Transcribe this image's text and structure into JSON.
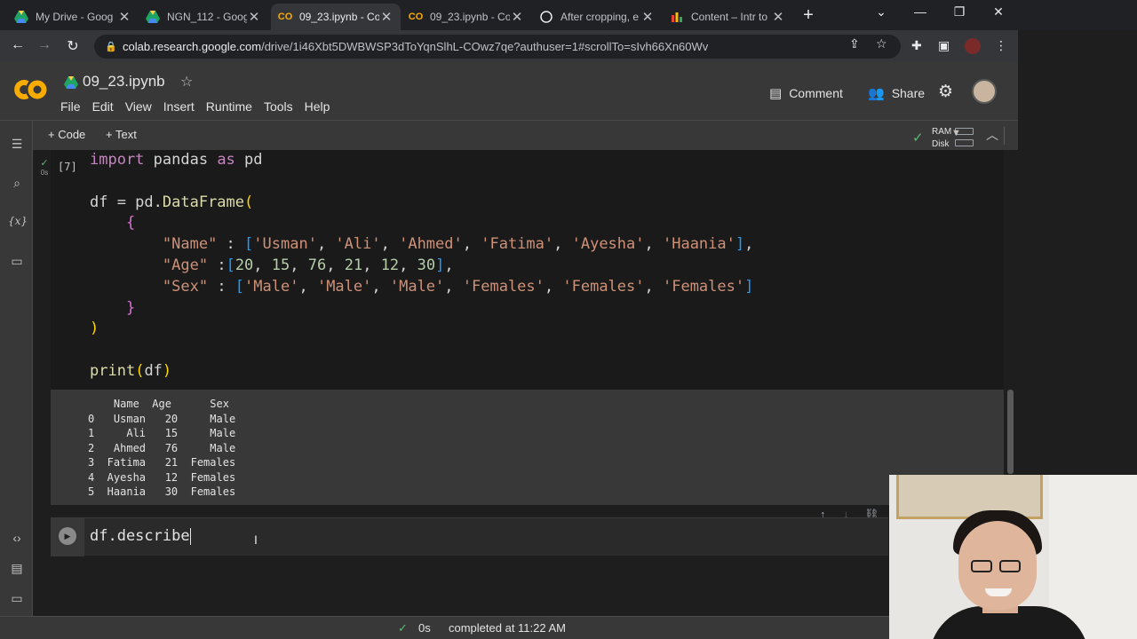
{
  "browser": {
    "tabs": [
      {
        "title": "My Drive - Goog",
        "icon": "drive-icon",
        "active": false
      },
      {
        "title": "NGN_112 - Goog",
        "icon": "drive-icon",
        "active": false
      },
      {
        "title": "09_23.ipynb - Co",
        "icon": "colab-icon",
        "active": true
      },
      {
        "title": "09_23.ipynb - Co",
        "icon": "colab-icon",
        "active": false
      },
      {
        "title": "After cropping, e",
        "icon": "github-icon",
        "active": false
      },
      {
        "title": "Content – Intr to",
        "icon": "studio-icon",
        "active": false
      }
    ],
    "url_host": "colab.research.google.com",
    "url_path": "/drive/1i46Xbt5DWBWSP3dToYqnSlhL-COwz7qe?authuser=1#scrollTo=sIvh66Xn60Wv"
  },
  "colab": {
    "notebook_name": "09_23.ipynb",
    "menu": [
      "File",
      "Edit",
      "View",
      "Insert",
      "Runtime",
      "Tools",
      "Help"
    ],
    "comment_label": "Comment",
    "share_label": "Share",
    "toolbar": {
      "code_label": "+ Code",
      "text_label": "+ Text",
      "ram_label": "RAM",
      "disk_label": "Disk"
    },
    "cell1": {
      "exec_count": "[7]",
      "exec_time": "0s"
    },
    "output_lines": [
      "    Name  Age      Sex",
      "0   Usman   20     Male",
      "1     Ali   15     Male",
      "2   Ahmed   76     Male",
      "3  Fatima   21  Females",
      "4  Ayesha   12  Females",
      "5  Haania   30  Females"
    ],
    "cell2_code": "df.describe",
    "status": {
      "time": "0s",
      "message": "completed at 11:22 AM"
    }
  },
  "colors": {
    "background": "#1e1e1e",
    "panel": "#383838",
    "keyword": "#c586c0",
    "string": "#ce9178",
    "number": "#b5cea8",
    "success": "#5bb974"
  }
}
